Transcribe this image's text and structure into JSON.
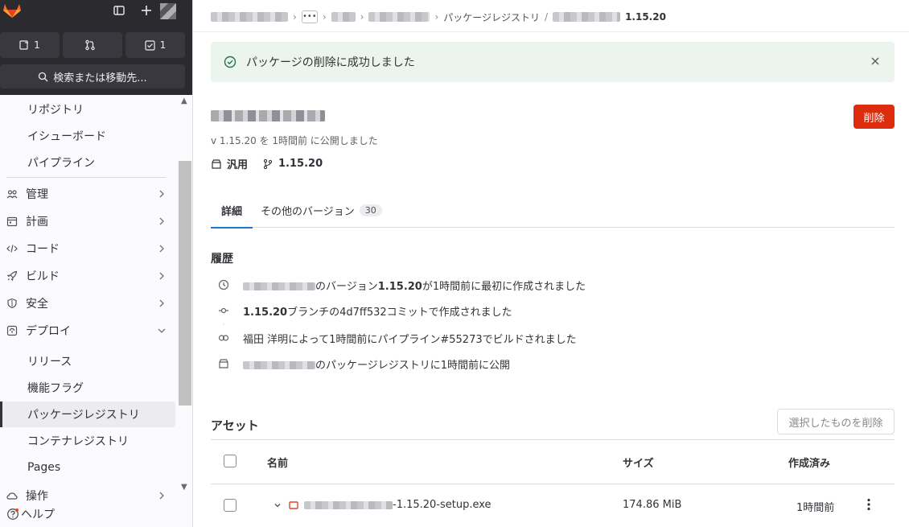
{
  "sidebar": {
    "counters": [
      {
        "icon": "issues-icon",
        "count": "1"
      },
      {
        "icon": "merge-requests-icon",
        "count": ""
      },
      {
        "icon": "todos-icon",
        "count": "1"
      }
    ],
    "search_label": "検索または移動先...",
    "items": [
      {
        "label": "リポジトリ"
      },
      {
        "label": "イシューボード"
      },
      {
        "label": "パイプライン"
      },
      {
        "label": "管理"
      },
      {
        "label": "計画"
      },
      {
        "label": "コード"
      },
      {
        "label": "ビルド"
      },
      {
        "label": "安全"
      },
      {
        "label": "デプロイ"
      },
      {
        "label": "リリース"
      },
      {
        "label": "機能フラグ"
      },
      {
        "label": "パッケージレジストリ"
      },
      {
        "label": "コンテナレジストリ"
      },
      {
        "label": "Pages"
      },
      {
        "label": "操作"
      }
    ],
    "help_label": "ヘルプ"
  },
  "breadcrumb": {
    "dots": "•••",
    "package_registry": "パッケージレジストリ",
    "version": "1.15.20"
  },
  "alert": {
    "message": "パッケージの削除に成功しました"
  },
  "package": {
    "delete_label": "削除",
    "published_line": "v 1.15.20 を 1時間前 に公開しました",
    "type_label": "汎用",
    "version_label": "1.15.20"
  },
  "tabs": [
    {
      "label": "詳細"
    },
    {
      "label": "その他のバージョン",
      "count": "30"
    }
  ],
  "history": {
    "title": "履歴",
    "rows": [
      {
        "icon": "clock-icon",
        "pre": "のバージョン",
        "bold": "1.15.20",
        "post": "が1時間前に最初に作成されました"
      },
      {
        "icon": "commit-icon",
        "bold": "1.15.20",
        "post": "ブランチの4d7ff532コミットで作成されました"
      },
      {
        "icon": "pipeline-icon",
        "text": "福田 洋明によって1時間前にパイプライン#55273でビルドされました"
      },
      {
        "icon": "package-icon",
        "post": "のパッケージレジストリに1時間前に公開"
      }
    ]
  },
  "assets": {
    "title": "アセット",
    "delete_selected_label": "選択したものを削除",
    "columns": {
      "name": "名前",
      "size": "サイズ",
      "created": "作成済み"
    },
    "rows": [
      {
        "name_suffix": "-1.15.20-setup.exe",
        "size": "174.86 MiB",
        "created": "1時間前"
      }
    ]
  },
  "colors": {
    "danger": "#dd2b0e",
    "success_bg": "#ecf4ee",
    "tab_active": "#1f75cb",
    "sidebar_dark": "#2b2a2f"
  }
}
